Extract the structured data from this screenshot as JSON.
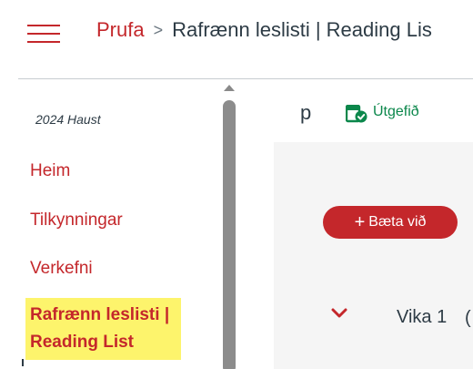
{
  "header": {
    "breadcrumb_course": "Prufa",
    "breadcrumb_separator": ">",
    "breadcrumb_current": "Rafrænn leslisti | Reading Lis"
  },
  "sidebar": {
    "term": "2024 Haust",
    "items": [
      {
        "label": "Heim"
      },
      {
        "label": "Tilkynningar"
      },
      {
        "label": "Verkefni"
      }
    ],
    "active_item": {
      "line1": "Rafrænn leslisti |",
      "line2": "Reading List"
    }
  },
  "content": {
    "toolbar_letter": "p",
    "published_label": "Útgefið",
    "add_button_label": "Bæta við",
    "add_button_plus": "+",
    "module_title": "Vika 1",
    "module_trailing": "("
  },
  "colors": {
    "brand_red": "#c4272b",
    "published_green": "#0b874b",
    "highlight_yellow": "#fdf46c",
    "panel_gray": "#f5f5f5",
    "text_dark": "#2d3b45"
  },
  "icons": {
    "menu": "hamburger-menu-icon",
    "published": "published-check-icon",
    "expand": "chevron-down-icon"
  }
}
